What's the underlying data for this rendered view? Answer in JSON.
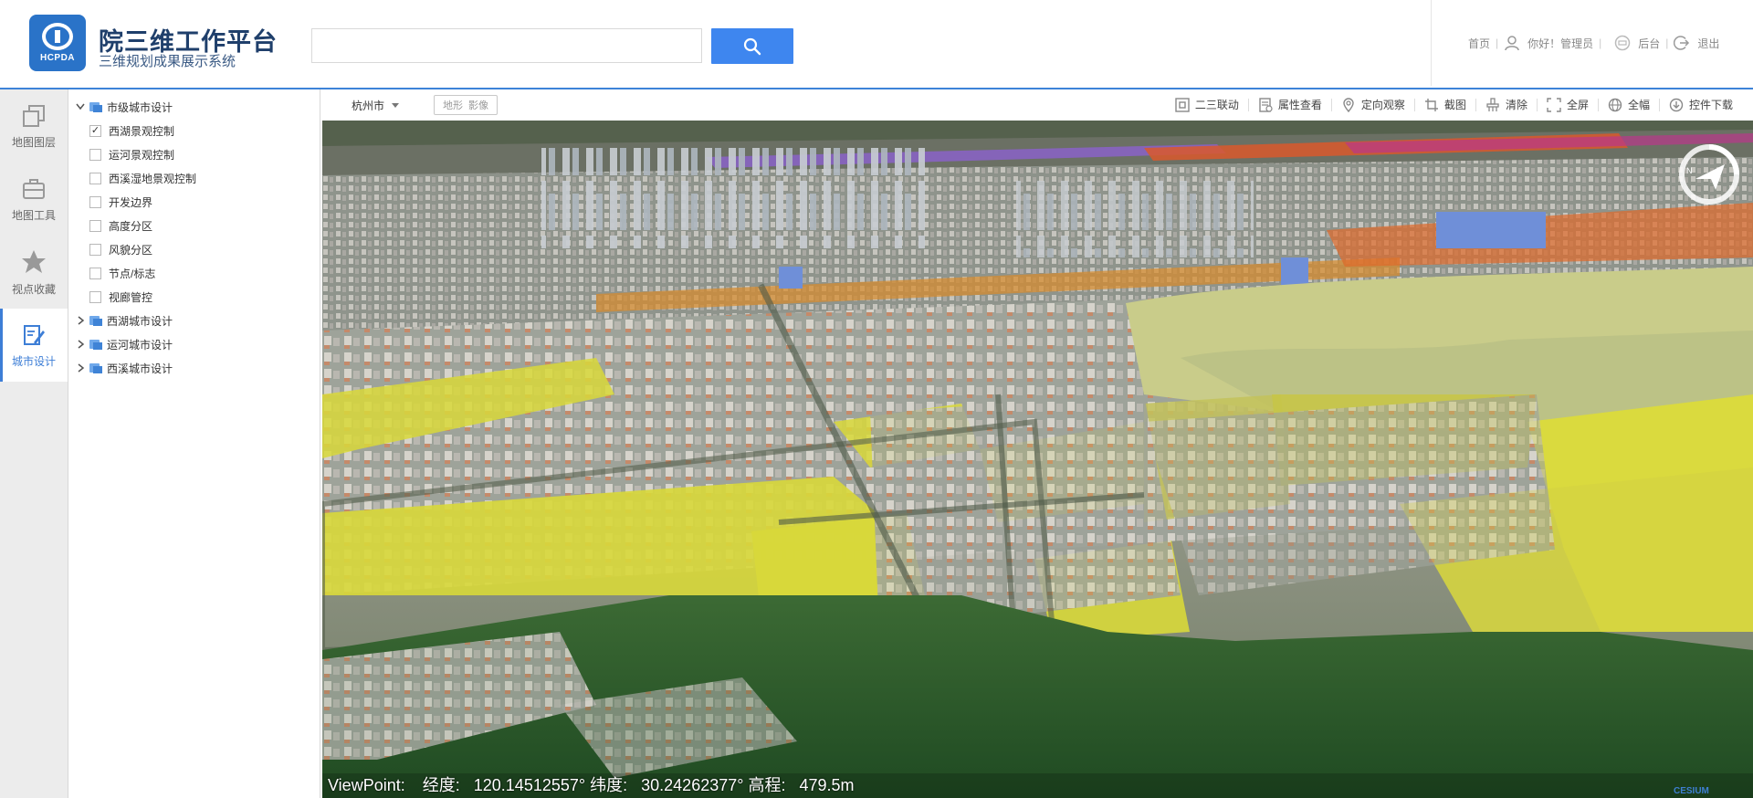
{
  "header": {
    "logo_text": "HCPDA",
    "title": "院三维工作平台",
    "subtitle": "三维规划成果展示系统",
    "search_placeholder": "",
    "links": {
      "home": "首页",
      "greeting": "你好！管理员",
      "backend": "后台",
      "logout": "退出"
    }
  },
  "rail": {
    "items": [
      {
        "label": "地图图层",
        "icon": "layers-icon"
      },
      {
        "label": "地图工具",
        "icon": "toolbox-icon"
      },
      {
        "label": "视点收藏",
        "icon": "star-icon"
      },
      {
        "label": "城市设计",
        "icon": "design-edit-icon",
        "active": true
      }
    ]
  },
  "tree": {
    "root": {
      "label": "市级城市设计",
      "expanded": true
    },
    "children": [
      {
        "label": "西湖景观控制",
        "checked": true,
        "visible": true
      },
      {
        "label": "运河景观控制",
        "checked": false,
        "visible": false
      },
      {
        "label": "西溪湿地景观控制",
        "checked": false,
        "visible": false
      },
      {
        "label": "开发边界",
        "checked": false,
        "visible": false
      },
      {
        "label": "高度分区",
        "checked": false,
        "visible": false
      },
      {
        "label": "风貌分区",
        "checked": false,
        "visible": false
      },
      {
        "label": "节点/标志",
        "checked": false,
        "visible": false
      },
      {
        "label": "视廊管控",
        "checked": false,
        "visible": false
      }
    ],
    "groups": [
      {
        "label": "西湖城市设计"
      },
      {
        "label": "运河城市设计"
      },
      {
        "label": "西溪城市设计"
      }
    ]
  },
  "map_toolbar": {
    "city": "杭州市",
    "toggle": [
      "地形",
      "影像"
    ],
    "tools": [
      {
        "label": "二三联动",
        "icon": "dual-view-icon"
      },
      {
        "label": "属性查看",
        "icon": "properties-icon"
      },
      {
        "label": "定向观察",
        "icon": "location-pin-icon"
      },
      {
        "label": "截图",
        "icon": "crop-icon"
      },
      {
        "label": "清除",
        "icon": "clear-icon"
      },
      {
        "label": "全屏",
        "icon": "fullscreen-icon"
      },
      {
        "label": "全幅",
        "icon": "globe-icon"
      },
      {
        "label": "控件下载",
        "icon": "download-icon"
      }
    ]
  },
  "map": {
    "viewpoint_label": "ViewPoint:",
    "lon_label": "经度:",
    "lon": "120.14512557°",
    "lat_label": "纬度:",
    "lat": "30.24262377°",
    "alt_label": "高程:",
    "alt": "479.5m",
    "watermark": "CESIUM"
  },
  "colors": {
    "accent": "#3e86ef",
    "rail_active": "#3d7ed6",
    "zone_yellow": "#d8d83a",
    "vegetation": "#2f5a2a"
  }
}
